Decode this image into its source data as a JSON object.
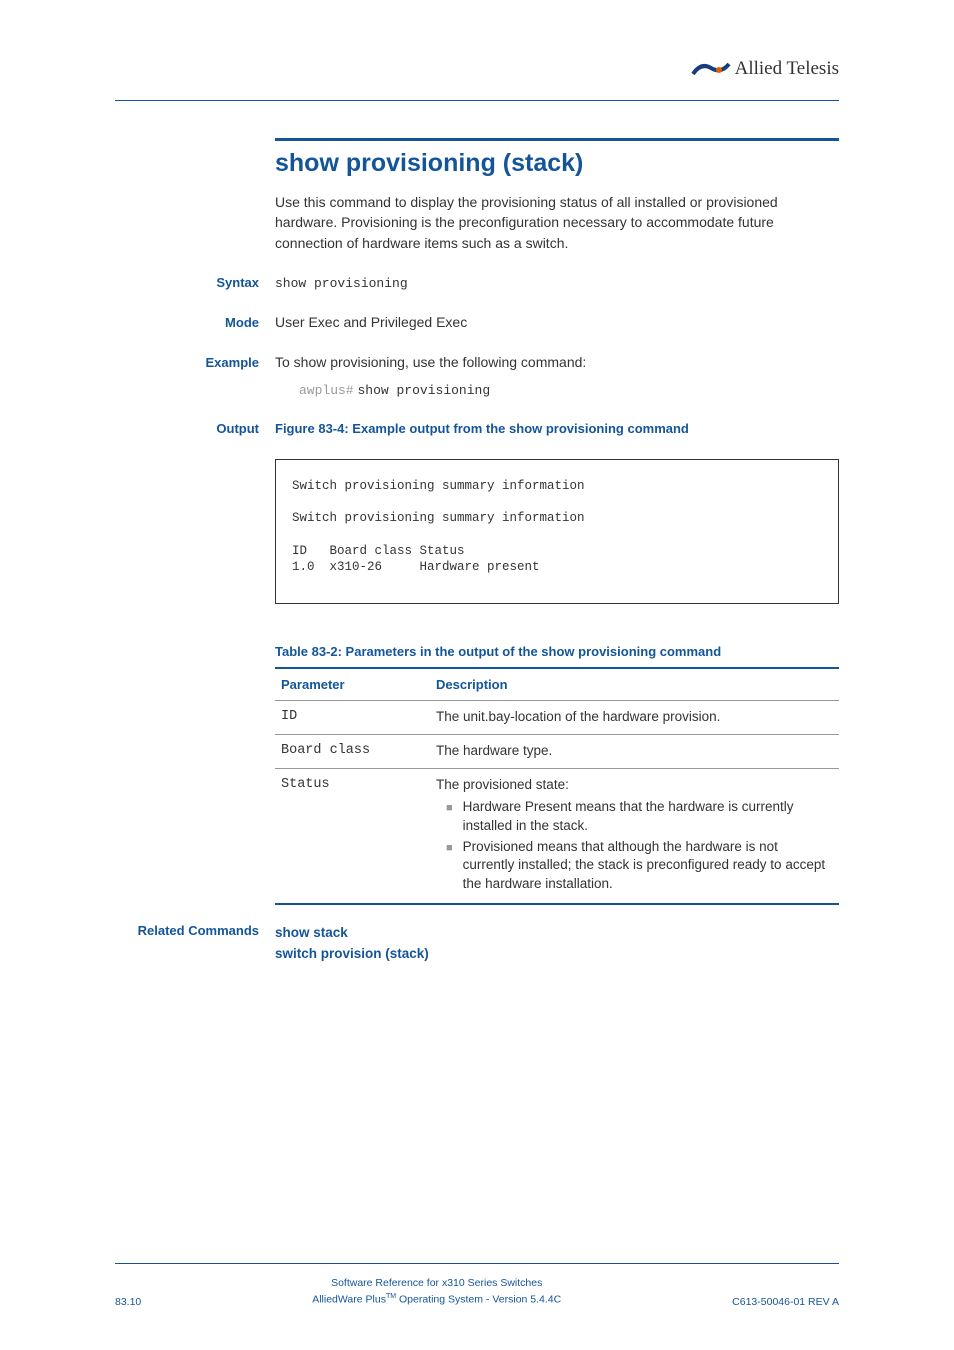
{
  "logo": {
    "brand": "Allied Telesis"
  },
  "title": "show provisioning (stack)",
  "intro": "Use this command to display the provisioning status of all installed or provisioned hardware. Provisioning is the preconfiguration necessary to accommodate future connection of hardware items such as a switch.",
  "syntax": {
    "label": "Syntax",
    "value": "show provisioning"
  },
  "mode": {
    "label": "Mode",
    "value": "User Exec and Privileged Exec"
  },
  "example": {
    "label": "Example",
    "text": "To show provisioning, use the following command:",
    "prompt": "awplus#",
    "command": "show provisioning"
  },
  "output": {
    "label": "Output",
    "fig_caption": "Figure 83-4: Example output from the show provisioning command",
    "box": "Switch provisioning summary information\n\nSwitch provisioning summary information\n\nID   Board class Status\n1.0  x310-26     Hardware present"
  },
  "table": {
    "caption": "Table 83-2: Parameters in the output of the show provisioning command",
    "header": {
      "param": "Parameter",
      "desc": "Description"
    },
    "rows": {
      "r0": {
        "param": "ID",
        "desc": "The unit.bay-location of the hardware provision."
      },
      "r1": {
        "param": "Board class",
        "desc": "The hardware type."
      },
      "r2": {
        "param": "Status",
        "desc": "The provisioned state:",
        "b0": "Hardware Present means that the hardware is currently installed in the stack.",
        "b1": "Provisioned means that although the hardware is not currently installed; the stack is preconfigured ready to accept the hardware installation."
      }
    }
  },
  "related": {
    "label": "Related Commands",
    "links": {
      "l0": "show stack",
      "l1": "switch provision (stack)"
    }
  },
  "footer": {
    "left": "83.10",
    "center1": "Software Reference for x310 Series Switches",
    "center2a": "AlliedWare Plus",
    "center2tm": "TM",
    "center2b": " Operating System  - Version 5.4.4C",
    "right": "C613-50046-01 REV A"
  },
  "chart_data": null
}
